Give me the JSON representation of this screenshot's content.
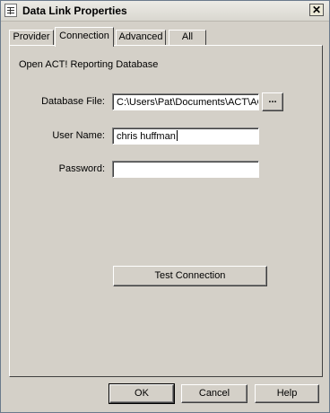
{
  "window": {
    "title": "Data Link Properties",
    "close_glyph": "✕"
  },
  "tabs": [
    {
      "label": "Provider",
      "active": false
    },
    {
      "label": "Connection",
      "active": true
    },
    {
      "label": "Advanced",
      "active": false
    },
    {
      "label": "All",
      "active": false
    }
  ],
  "connection": {
    "heading": "Open ACT! Reporting Database",
    "database_file": {
      "label": "Database File:",
      "value": "C:\\Users\\Pat\\Documents\\ACT\\AC"
    },
    "browse_label": "...",
    "user_name": {
      "label": "User Name:",
      "value": "chris huffman"
    },
    "password": {
      "label": "Password:",
      "value": ""
    },
    "test_button": "Test Connection"
  },
  "footer": {
    "ok_label": "OK",
    "cancel_label": "Cancel",
    "help_label": "Help"
  },
  "icons": {
    "window_icon": "data-link-icon",
    "close_icon": "close-icon"
  }
}
